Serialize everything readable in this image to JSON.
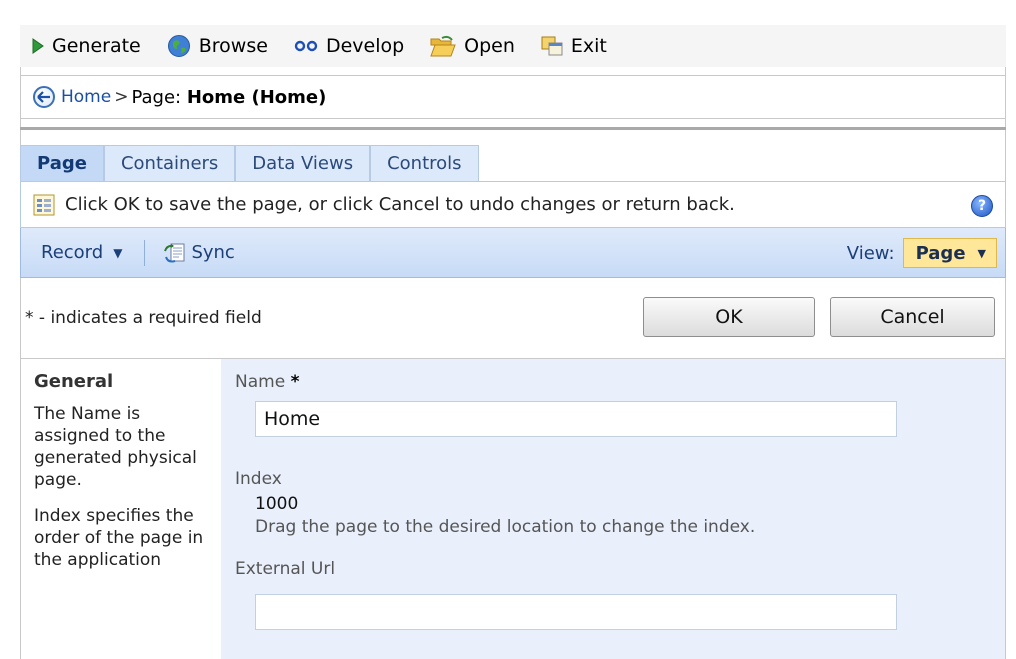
{
  "toolbar": {
    "items": [
      {
        "label": "Generate",
        "icon": "play-icon"
      },
      {
        "label": "Browse",
        "icon": "globe-icon"
      },
      {
        "label": "Develop",
        "icon": "infinity-icon"
      },
      {
        "label": "Open",
        "icon": "folder-open-icon"
      },
      {
        "label": "Exit",
        "icon": "exit-icon"
      }
    ]
  },
  "breadcrumb": {
    "home_link": "Home",
    "separator": ">",
    "page_prefix": "Page: ",
    "page_name": "Home (Home)"
  },
  "tabs": [
    {
      "label": "Page",
      "active": true
    },
    {
      "label": "Containers",
      "active": false
    },
    {
      "label": "Data Views",
      "active": false
    },
    {
      "label": "Controls",
      "active": false
    }
  ],
  "message": {
    "text": "Click OK to save the page, or click Cancel to undo changes or return back.",
    "help_icon": "help-icon"
  },
  "actionbar": {
    "record_label": "Record",
    "sync_label": "Sync",
    "view_label": "View:",
    "view_value": "Page"
  },
  "form": {
    "required_note": "* - indicates a required field",
    "ok_label": "OK",
    "cancel_label": "Cancel"
  },
  "left_panel": {
    "heading": "General",
    "para1": "The Name is assigned to the generated physical page.",
    "para2": "Index specifies the order of the page in the application"
  },
  "fields": {
    "name_label": "Name",
    "name_required": "*",
    "name_value": "Home",
    "index_label": "Index",
    "index_value": "1000",
    "index_hint": "Drag the page to the desired location to change the index.",
    "external_url_label": "External Url",
    "external_url_value": ""
  },
  "colors": {
    "accent": "#1a4fa3",
    "tab_bg": "#dce9fa",
    "view_highlight": "#ffe79a",
    "form_bg": "#e9f0fc"
  }
}
